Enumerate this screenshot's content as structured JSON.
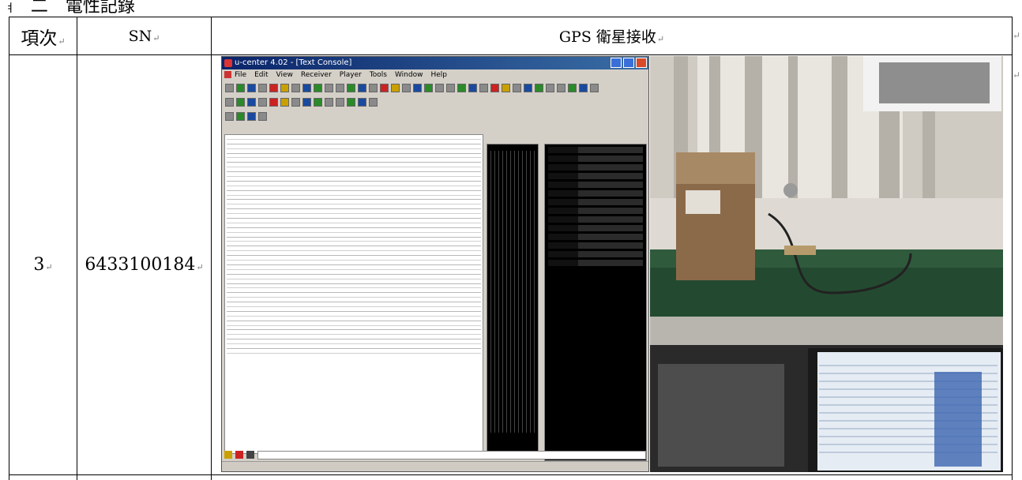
{
  "heading": {
    "mark": "ㅕ",
    "text": "二　電性記錄"
  },
  "table": {
    "headers": {
      "item": "項次",
      "sn": "SN",
      "gps": "GPS 衛星接收"
    },
    "row": {
      "item": "3",
      "sn": "6433100184"
    },
    "return_mark": "↵"
  },
  "screenshot": {
    "title": "u-center 4.02 - [Text Console]",
    "menu": [
      "File",
      "Edit",
      "View",
      "Receiver",
      "Player",
      "Tools",
      "Window",
      "Help"
    ]
  },
  "colors": {
    "border": "#000000",
    "titlebar": "#0a246a"
  }
}
